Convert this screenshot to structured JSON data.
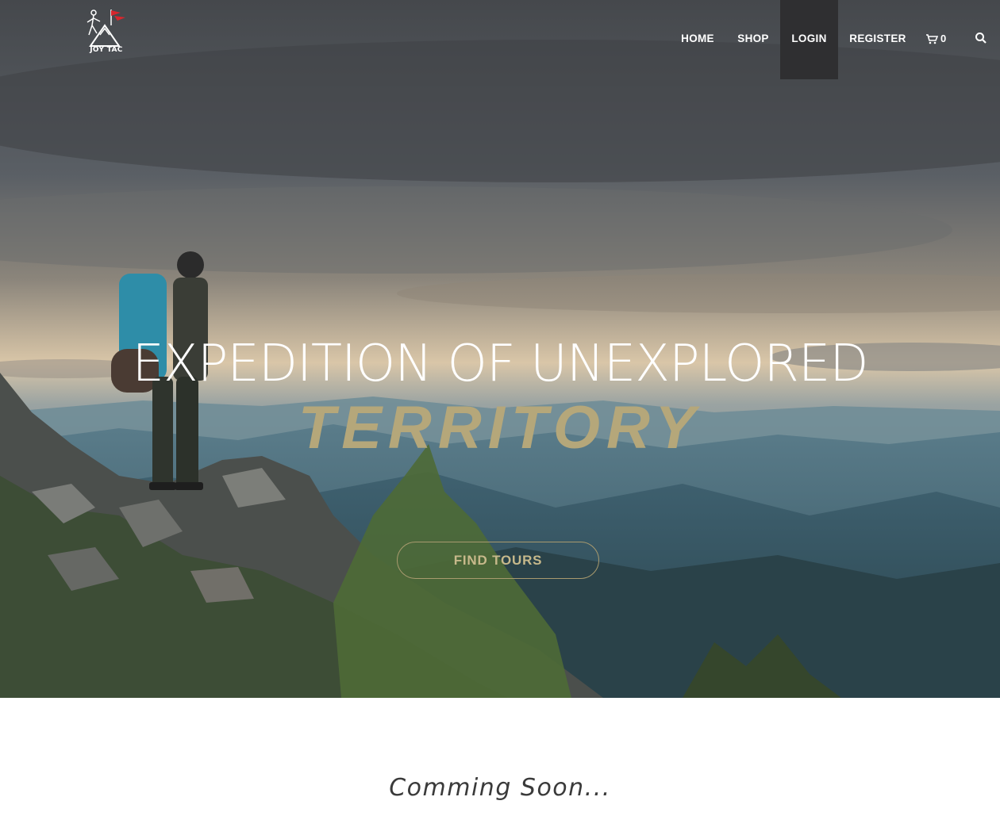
{
  "brand": {
    "logo_text": "JOY TAC",
    "flag_color": "#d9262c"
  },
  "nav": {
    "items": [
      {
        "label": "HOME"
      },
      {
        "label": "SHOP"
      },
      {
        "label": "LOGIN",
        "active": true
      },
      {
        "label": "REGISTER"
      }
    ],
    "cart_count": "0",
    "cart_icon": "cart-icon",
    "search_icon": "search-icon"
  },
  "hero": {
    "headline": "EXPEDITION OF UNEXPLORED",
    "subheadline": "TERRITORY",
    "cta_label": "FIND TOURS",
    "accent_color": "#b5a77a"
  },
  "footer": {
    "coming_soon": "Comming Soon..."
  }
}
